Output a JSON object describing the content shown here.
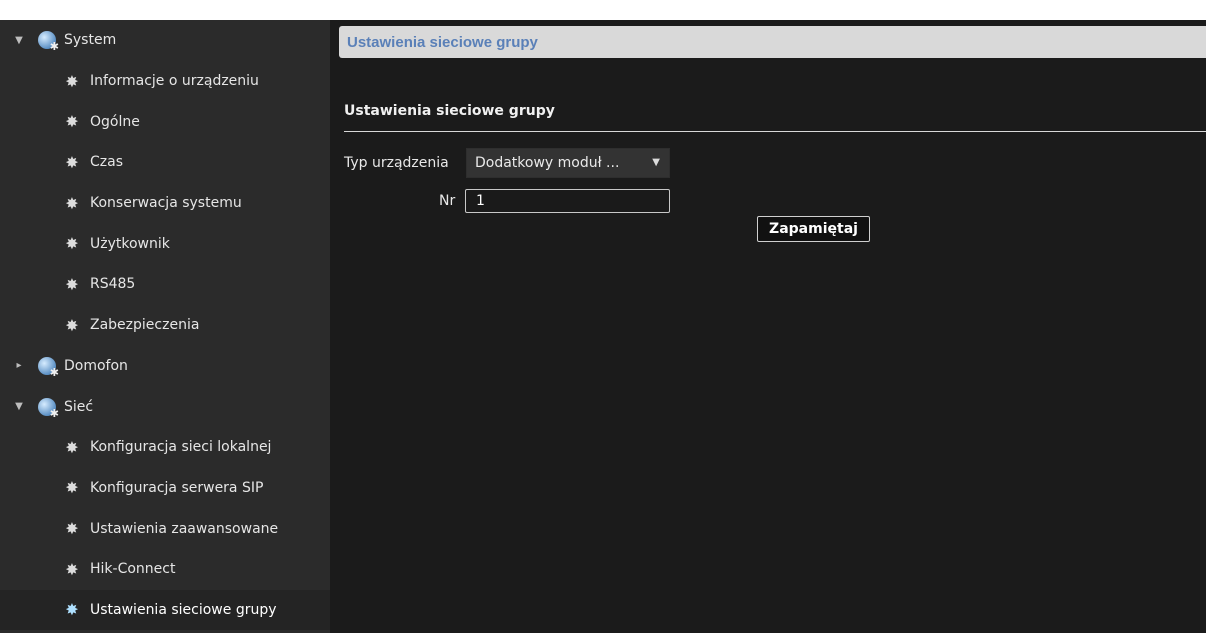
{
  "sidebar": {
    "system": {
      "label": "System",
      "items": [
        {
          "label": "Informacje o urządzeniu"
        },
        {
          "label": "Ogólne"
        },
        {
          "label": "Czas"
        },
        {
          "label": "Konserwacja systemu"
        },
        {
          "label": "Użytkownik"
        },
        {
          "label": "RS485"
        },
        {
          "label": "Zabezpieczenia"
        }
      ]
    },
    "domofon": {
      "label": "Domofon"
    },
    "siec": {
      "label": "Sieć",
      "items": [
        {
          "label": "Konfiguracja sieci lokalnej"
        },
        {
          "label": "Konfiguracja serwera SIP"
        },
        {
          "label": "Ustawienia zaawansowane"
        },
        {
          "label": "Hik-Connect"
        },
        {
          "label": "Ustawienia sieciowe grupy"
        }
      ]
    },
    "icons": {
      "expanded": "caret-down-icon",
      "collapsed": "caret-right-icon",
      "group": "globe-gear-icon",
      "item": "gear-icon"
    }
  },
  "main": {
    "title": "Ustawienia sieciowe grupy",
    "section_title": "Ustawienia sieciowe grupy",
    "device_type": {
      "label": "Typ urządzenia",
      "value": "Dodatkowy moduł ..."
    },
    "number": {
      "label": "Nr",
      "value": "1"
    },
    "save_label": "Zapamiętaj"
  },
  "colors": {
    "sidebar_bg": "#2b2b2b",
    "main_bg": "#1b1b1b",
    "titlebar_bg": "#d9d9d9",
    "title_text": "#5a80b8"
  }
}
